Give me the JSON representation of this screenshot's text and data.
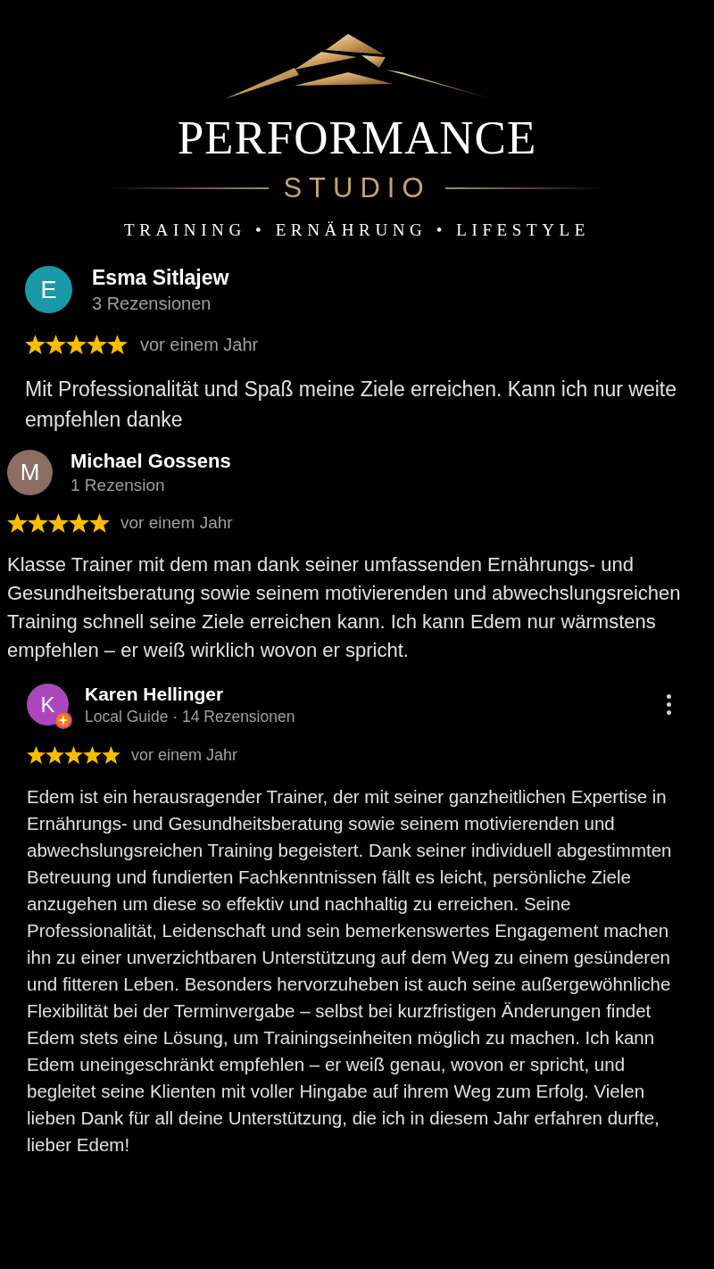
{
  "logo": {
    "title": "PERFORMANCE",
    "subtitle": "STUDIO",
    "tagline": "TRAINING • ERNÄHRUNG • LIFESTYLE"
  },
  "reviews": [
    {
      "initial": "E",
      "color": "#1a9aa8",
      "name": "Esma Sitlajew",
      "meta": "3 Rezensionen",
      "local_guide": false,
      "has_menu": false,
      "stars": 5,
      "time": "vor einem Jahr",
      "text": "Mit Professionalität und Spaß meine Ziele erreichen. Kann ich nur weite empfehlen danke"
    },
    {
      "initial": "M",
      "color": "#8d6e63",
      "name": "Michael Gossens",
      "meta": "1 Rezension",
      "local_guide": false,
      "has_menu": false,
      "stars": 5,
      "time": "vor einem Jahr",
      "text": "Klasse Trainer mit dem man dank seiner umfassenden Ernährungs- und Gesundheitsberatung sowie seinem motivierenden und abwechslungsreichen Training schnell seine Ziele erreichen kann. Ich kann Edem nur wärmstens empfehlen – er weiß wirklich wovon er spricht."
    },
    {
      "initial": "K",
      "color": "#ab47bc",
      "name": "Karen Hellinger",
      "meta": "Local Guide · 14 Rezensionen",
      "local_guide": true,
      "has_menu": true,
      "stars": 5,
      "time": "vor einem Jahr",
      "text": "Edem ist ein herausragender Trainer, der mit seiner ganzheitlichen Expertise in Ernährungs- und Gesundheitsberatung sowie seinem motivierenden und abwechslungsreichen Training begeistert. Dank seiner individuell abgestimmten Betreuung und fundierten Fachkenntnissen fällt es leicht, persönliche Ziele anzugehen um diese so effektiv und nachhaltig zu erreichen. Seine Professionalität, Leidenschaft und sein bemerkenswertes Engagement machen ihn zu einer unverzichtbaren Unterstützung auf dem Weg zu einem gesünderen und fitteren Leben. Besonders hervorzuheben ist auch seine außergewöhnliche Flexibilität bei der Terminvergabe – selbst bei kurzfristigen Änderungen findet Edem stets eine Lösung, um Trainingseinheiten möglich zu machen. Ich kann Edem uneingeschränkt empfehlen – er weiß genau, wovon er spricht, und begleitet seine Klienten mit voller Hingabe auf ihrem Weg zum Erfolg. Vielen lieben Dank für all deine Unterstützung, die ich in diesem Jahr erfahren durfte, lieber Edem!"
    }
  ]
}
